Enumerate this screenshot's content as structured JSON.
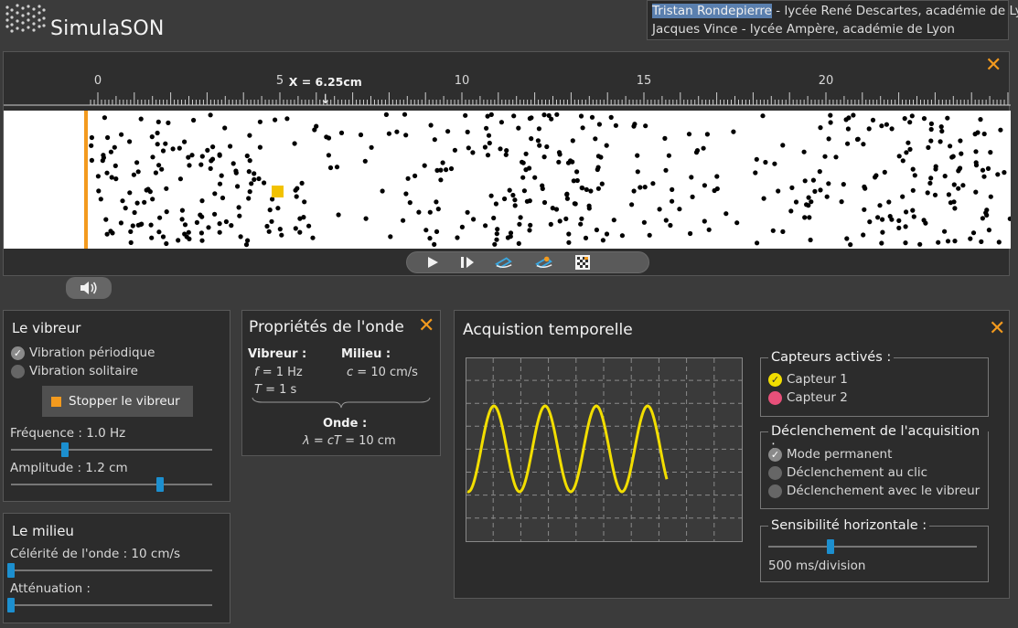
{
  "app": {
    "title": "SimulaSON"
  },
  "credits": {
    "line1_name": "Tristan Rondepierre",
    "line1_rest": " - lycée René Descartes, académie de Lyon",
    "line2": "Jacques Vince - lycée Ampère, académie de Lyon"
  },
  "ruler": {
    "ticks": [
      "0",
      "5",
      "10",
      "15",
      "20"
    ],
    "cursor_label": "X = 6.25cm",
    "cursor_arrow": "↓"
  },
  "colors": {
    "accent": "#f39a1e",
    "slider": "#1c8fcf",
    "signal": "#f2de00",
    "sensor2": "#e8507a"
  },
  "sim_controls": {
    "play_icon": "play-icon",
    "step_icon": "step-icon",
    "sensor1_icon": "sensor-probe-icon",
    "sensor2_icon": "sensor-probe-icon",
    "grid_icon": "pattern-icon"
  },
  "vibreur": {
    "title": "Le vibreur",
    "option_periodic": "Vibration périodique",
    "option_solitary": "Vibration solitaire",
    "selected": "periodic",
    "stop_label": "Stopper le vibreur",
    "freq_label": "Fréquence : 1.0 Hz",
    "freq_level": 0.27,
    "amp_label": "Amplitude : 1.2 cm",
    "amp_level": 0.74
  },
  "milieu": {
    "title": "Le milieu",
    "speed_label": "Célérité de l'onde : 10 cm/s",
    "speed_level": 0.0,
    "attenuation_label": "Atténuation :",
    "attenuation_level": 0.0
  },
  "props": {
    "title": "Propriétés de l'onde",
    "vibreur_head": "Vibreur :",
    "f_sym": "f",
    "f_val": " = 1 Hz",
    "T_sym": "T",
    "T_val": " = 1 s",
    "milieu_head": "Milieu :",
    "c_sym": "c",
    "c_val": " = 10 cm/s",
    "onde_head": "Onde :",
    "lambda_sym": "λ",
    "lambda_mid": " = ",
    "lambda_cT": "cT",
    "lambda_val": " = 10 cm"
  },
  "acq": {
    "title": "Acquistion temporelle",
    "capteurs_title": "Capteurs activés :",
    "capteur1": "Capteur 1",
    "capteur2": "Capteur 2",
    "declench_title": "Déclenchement de l'acquisition :",
    "mode_permanent": "Mode permanent",
    "mode_clic": "Déclenchement au clic",
    "mode_vibreur": "Déclenchement avec le vibreur",
    "selected_mode": "permanent",
    "sens_title": "Sensibilité horizontale :",
    "sens_label": "500 ms/division",
    "sens_level": 0.3
  }
}
